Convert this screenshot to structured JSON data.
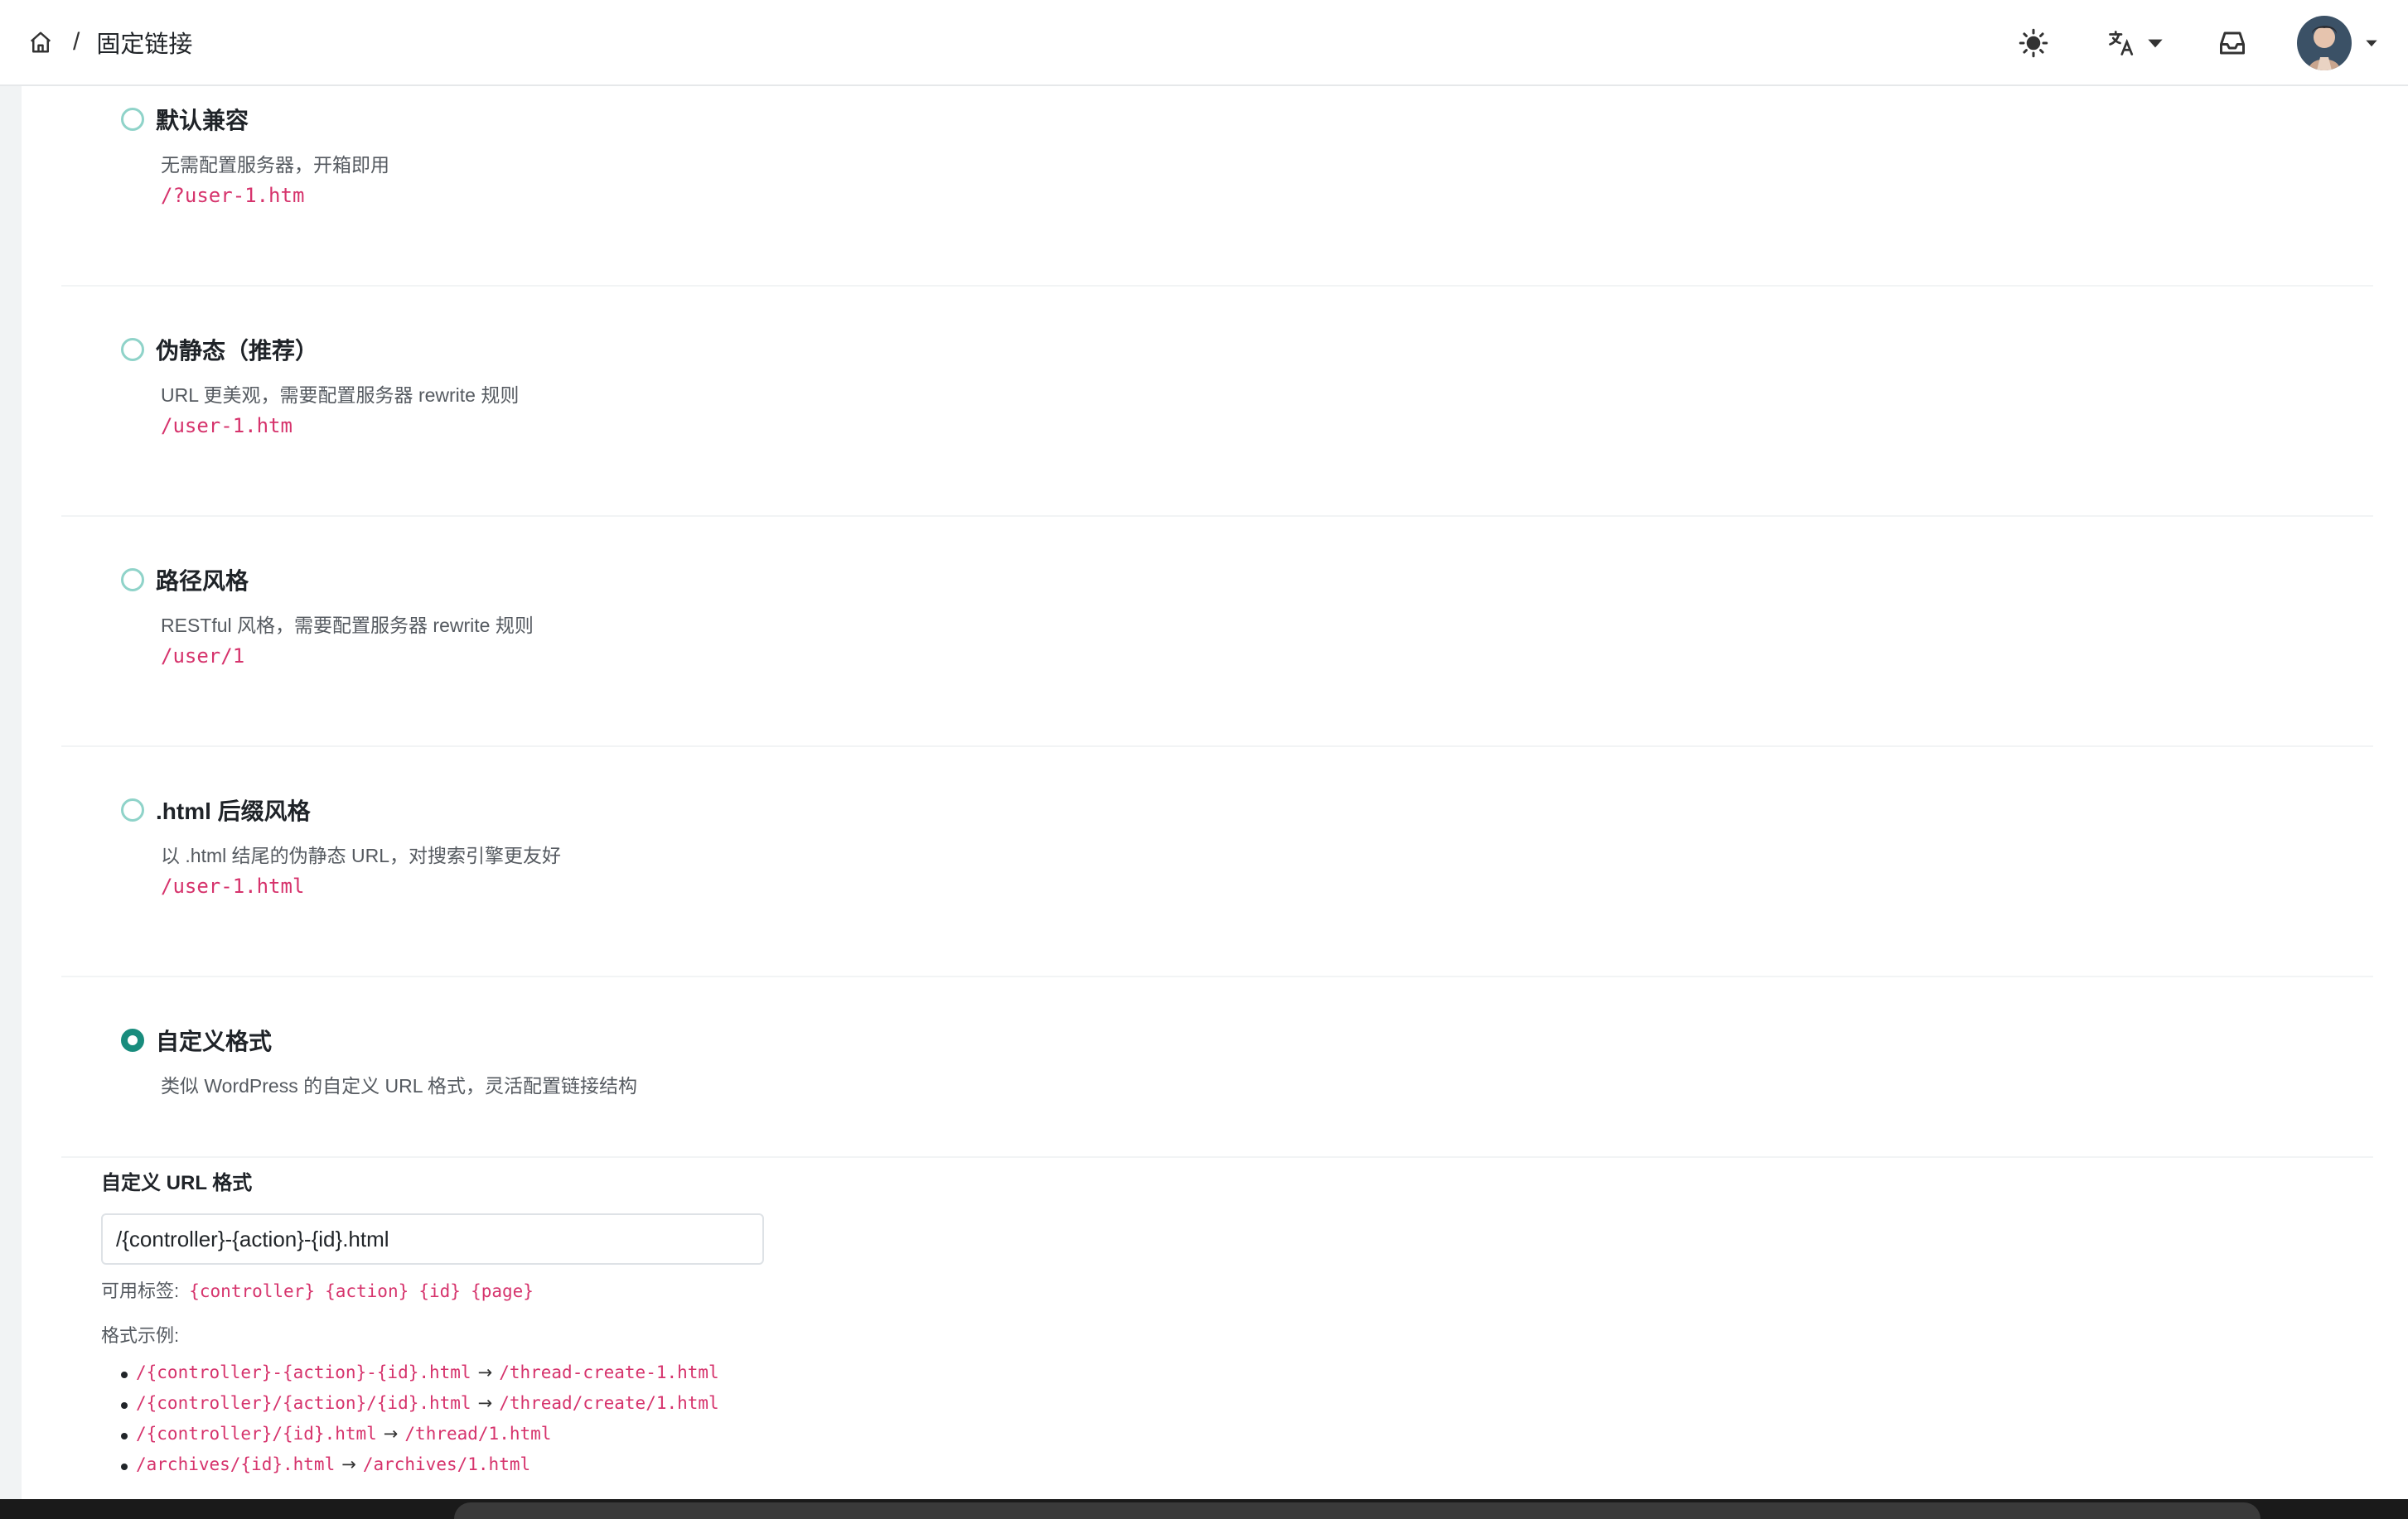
{
  "header": {
    "breadcrumb_sep": "/",
    "title": "固定链接",
    "icons": [
      "home-icon",
      "sun-icon",
      "translate-icon",
      "inbox-icon",
      "avatar",
      "caret-down-icon"
    ]
  },
  "options": [
    {
      "title": "默认兼容",
      "desc": "无需配置服务器，开箱即用",
      "code": "/?user-1.htm",
      "checked": false
    },
    {
      "title": "伪静态（推荐）",
      "desc": "URL 更美观，需要配置服务器 rewrite 规则",
      "code": "/user-1.htm",
      "checked": false
    },
    {
      "title": "路径风格",
      "desc": "RESTful 风格，需要配置服务器 rewrite 规则",
      "code": "/user/1",
      "checked": false
    },
    {
      "title": ".html 后缀风格",
      "desc": "以 .html 结尾的伪静态 URL，对搜索引擎更友好",
      "code": "/user-1.html",
      "checked": false
    },
    {
      "title": "自定义格式",
      "desc": "类似 WordPress 的自定义 URL 格式，灵活配置链接结构",
      "code": "",
      "checked": true
    }
  ],
  "custom": {
    "label": "自定义 URL 格式",
    "value": "/{controller}-{action}-{id}.html",
    "tags_label": "可用标签:",
    "tags": [
      "{controller}",
      "{action}",
      "{id}",
      "{page}"
    ],
    "examples_label": "格式示例:",
    "arrow": "→",
    "examples": [
      {
        "pattern": "/{controller}-{action}-{id}.html",
        "result": "/thread-create-1.html"
      },
      {
        "pattern": "/{controller}/{action}/{id}.html",
        "result": "/thread/create/1.html"
      },
      {
        "pattern": "/{controller}/{id}.html",
        "result": "/thread/1.html"
      },
      {
        "pattern": "/archives/{id}.html",
        "result": "/archives/1.html"
      }
    ]
  },
  "colors": {
    "accent": "#198c7d",
    "code": "#d6336c"
  }
}
